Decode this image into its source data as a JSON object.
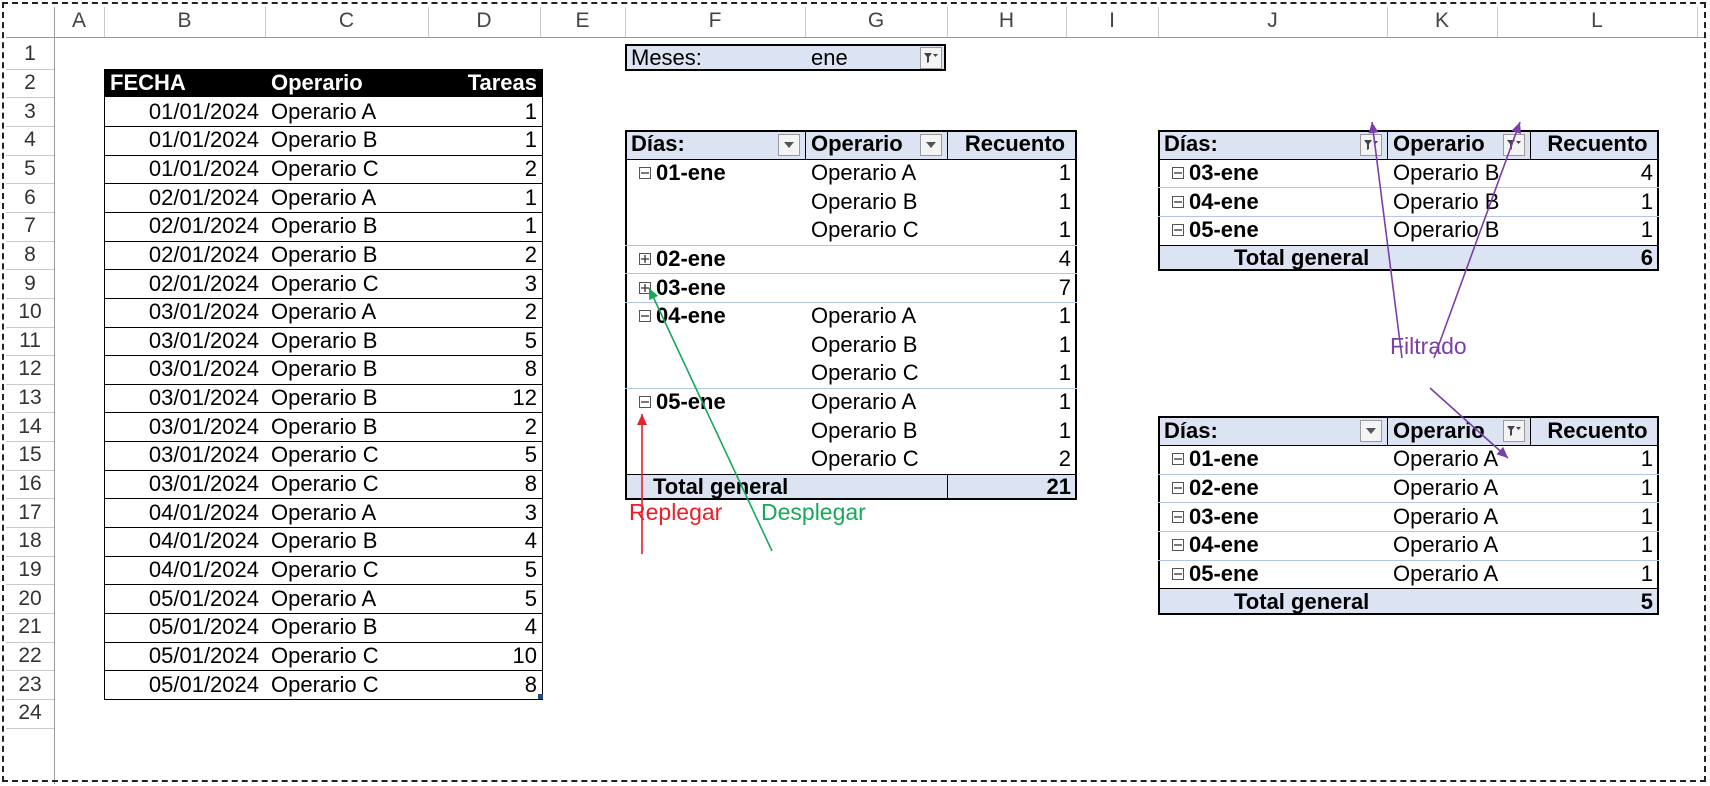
{
  "sheet": {
    "columns": [
      "A",
      "B",
      "C",
      "D",
      "E",
      "F",
      "G",
      "H",
      "I",
      "J",
      "K",
      "L"
    ],
    "rows": [
      "1",
      "2",
      "3",
      "4",
      "5",
      "6",
      "7",
      "8",
      "9",
      "10",
      "11",
      "12",
      "13",
      "14",
      "15",
      "16",
      "17",
      "18",
      "19",
      "20",
      "21",
      "22",
      "23",
      "24"
    ]
  },
  "source_table": {
    "headers": [
      "FECHA",
      "Operario",
      "Tareas"
    ],
    "rows": [
      [
        "01/01/2024",
        "Operario A",
        "1"
      ],
      [
        "01/01/2024",
        "Operario B",
        "1"
      ],
      [
        "01/01/2024",
        "Operario C",
        "2"
      ],
      [
        "02/01/2024",
        "Operario A",
        "1"
      ],
      [
        "02/01/2024",
        "Operario B",
        "1"
      ],
      [
        "02/01/2024",
        "Operario B",
        "2"
      ],
      [
        "02/01/2024",
        "Operario C",
        "3"
      ],
      [
        "03/01/2024",
        "Operario A",
        "2"
      ],
      [
        "03/01/2024",
        "Operario B",
        "5"
      ],
      [
        "03/01/2024",
        "Operario B",
        "8"
      ],
      [
        "03/01/2024",
        "Operario B",
        "12"
      ],
      [
        "03/01/2024",
        "Operario B",
        "2"
      ],
      [
        "03/01/2024",
        "Operario C",
        "5"
      ],
      [
        "03/01/2024",
        "Operario C",
        "8"
      ],
      [
        "04/01/2024",
        "Operario A",
        "3"
      ],
      [
        "04/01/2024",
        "Operario B",
        "4"
      ],
      [
        "04/01/2024",
        "Operario C",
        "5"
      ],
      [
        "05/01/2024",
        "Operario A",
        "5"
      ],
      [
        "05/01/2024",
        "Operario B",
        "4"
      ],
      [
        "05/01/2024",
        "Operario C",
        "10"
      ],
      [
        "05/01/2024",
        "Operario C",
        "8"
      ]
    ]
  },
  "filter": {
    "label": "Meses:",
    "value": "ene"
  },
  "pivot_main": {
    "headers": [
      "Días:",
      "Operario",
      "Recuento"
    ],
    "rows": [
      {
        "day": "01-ene",
        "toggle": "minus",
        "operator": "Operario A",
        "count": "1"
      },
      {
        "day": "",
        "toggle": "",
        "operator": "Operario B",
        "count": "1"
      },
      {
        "day": "",
        "toggle": "",
        "operator": "Operario C",
        "count": "1"
      },
      {
        "day": "02-ene",
        "toggle": "plus",
        "operator": "",
        "count": "4"
      },
      {
        "day": "03-ene",
        "toggle": "plus",
        "operator": "",
        "count": "7"
      },
      {
        "day": "04-ene",
        "toggle": "minus",
        "operator": "Operario A",
        "count": "1"
      },
      {
        "day": "",
        "toggle": "",
        "operator": "Operario B",
        "count": "1"
      },
      {
        "day": "",
        "toggle": "",
        "operator": "Operario C",
        "count": "1"
      },
      {
        "day": "05-ene",
        "toggle": "minus",
        "operator": "Operario A",
        "count": "1"
      },
      {
        "day": "",
        "toggle": "",
        "operator": "Operario B",
        "count": "1"
      },
      {
        "day": "",
        "toggle": "",
        "operator": "Operario C",
        "count": "2"
      }
    ],
    "total_label": "Total general",
    "total_value": "21"
  },
  "pivot_top_right": {
    "headers": [
      "Días:",
      "Operario",
      "Recuento"
    ],
    "rows": [
      {
        "day": "03-ene",
        "operator": "Operario B",
        "count": "4"
      },
      {
        "day": "04-ene",
        "operator": "Operario B",
        "count": "1"
      },
      {
        "day": "05-ene",
        "operator": "Operario B",
        "count": "1"
      }
    ],
    "total_label": "Total general",
    "total_value": "6"
  },
  "pivot_bottom_right": {
    "headers": [
      "Días:",
      "Operario",
      "Recuento"
    ],
    "rows": [
      {
        "day": "01-ene",
        "operator": "Operario A",
        "count": "1"
      },
      {
        "day": "02-ene",
        "operator": "Operario A",
        "count": "1"
      },
      {
        "day": "03-ene",
        "operator": "Operario A",
        "count": "1"
      },
      {
        "day": "04-ene",
        "operator": "Operario A",
        "count": "1"
      },
      {
        "day": "05-ene",
        "operator": "Operario A",
        "count": "1"
      }
    ],
    "total_label": "Total general",
    "total_value": "5"
  },
  "annotations": {
    "replegar": "Replegar",
    "desplegar": "Desplegar",
    "filtrado": "Filtrado"
  },
  "colors": {
    "pivot_band": "#dce4f4",
    "replegar": "#e8202a",
    "desplegar": "#18a85a",
    "filtrado": "#7a3fa8"
  }
}
